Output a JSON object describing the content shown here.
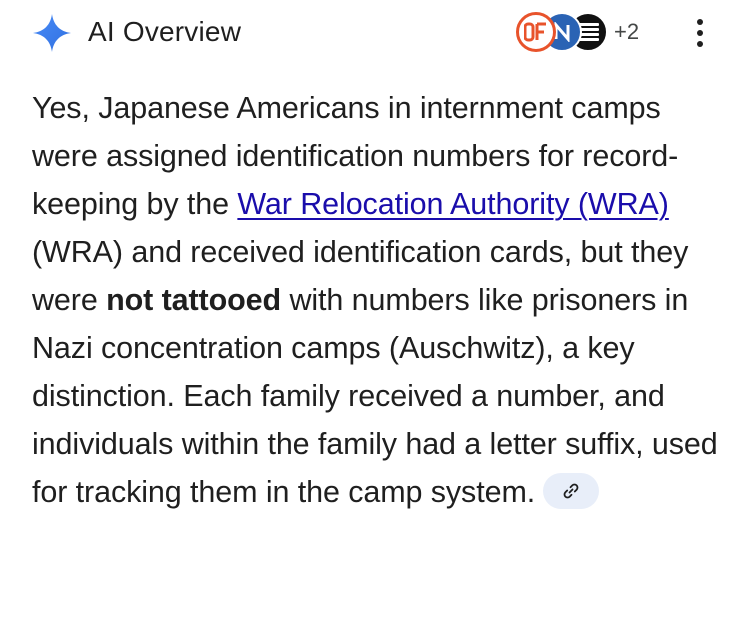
{
  "header": {
    "title": "AI Overview",
    "more_sources": "+2",
    "accent_icon": "sparkle-icon",
    "sparkle_color": "#4285f4",
    "source_icons": [
      "source-favicon-1",
      "source-favicon-2",
      "source-favicon-3"
    ]
  },
  "answer": {
    "intro": "Yes, Japanese Americans in internment camps were assigned identification numbers for record-keeping by the ",
    "link_text": "War Relocation Authority (WRA)",
    "after_link": " (WRA) and received identification cards, but they were ",
    "bold_text": "not tattooed",
    "rest": " with numbers like prisoners in Nazi concentration camps (Auschwitz), a key distinction. Each family received a number, and individuals within the family had a letter suffix, used for tracking them in the camp system.",
    "citation_icon": "link-icon"
  },
  "colors": {
    "link": "#1a0dab",
    "text": "#1f1f1f",
    "chip_bg": "#e8eef9"
  }
}
